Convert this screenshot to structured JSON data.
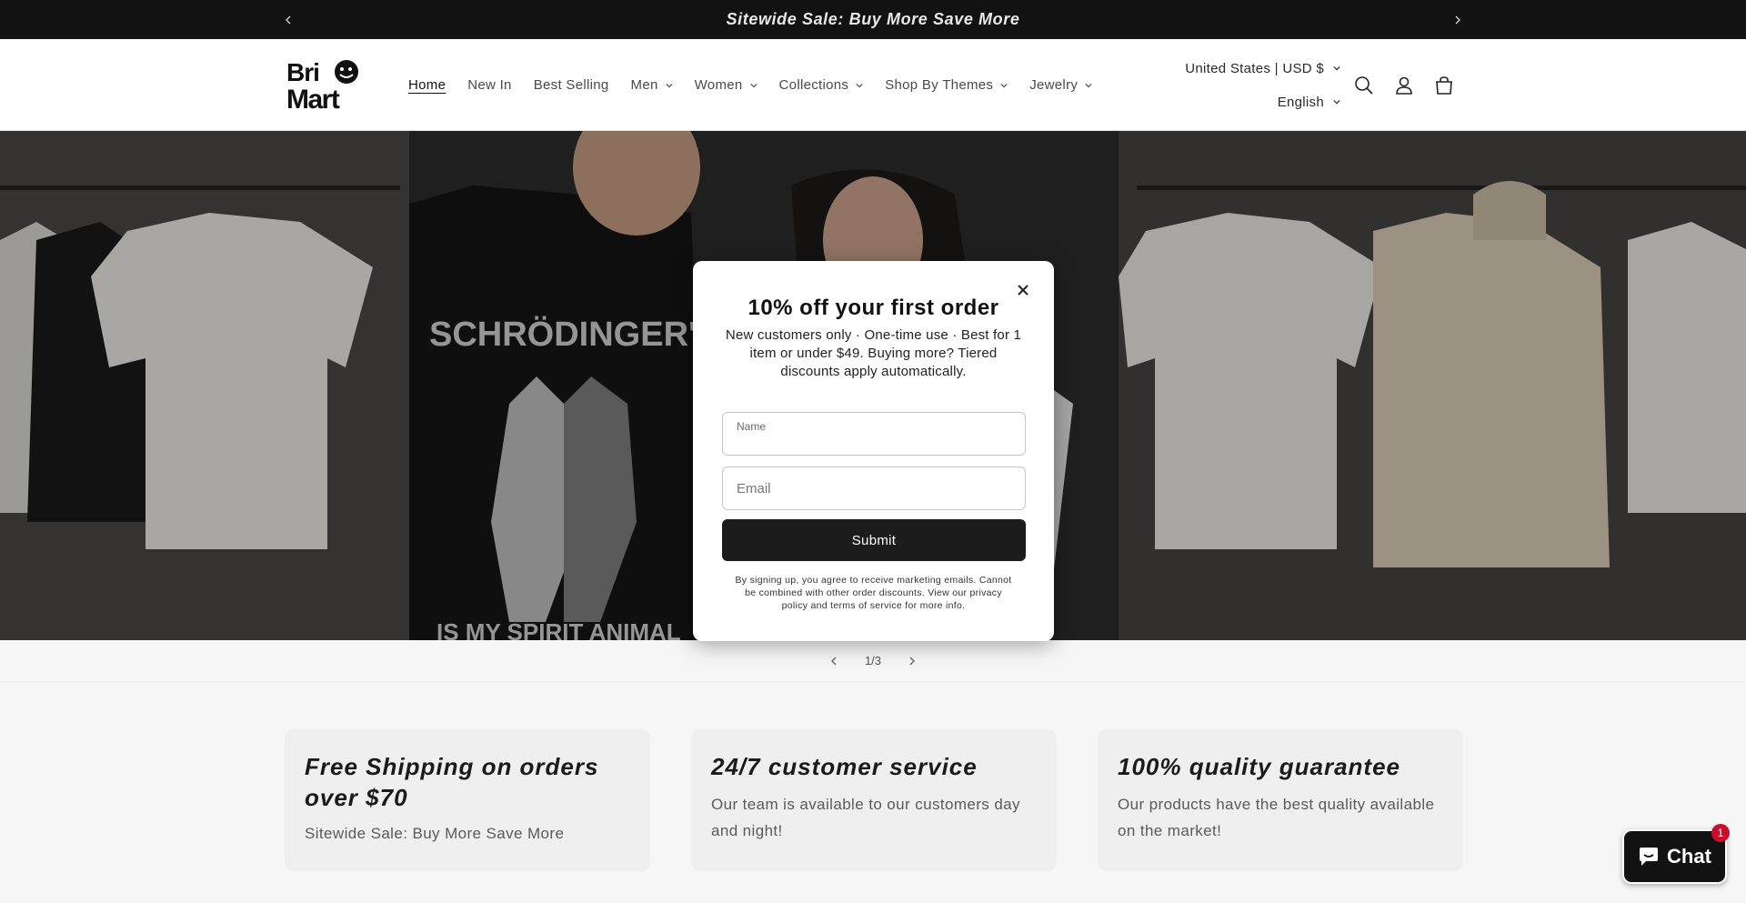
{
  "announcement": {
    "text": "Sitewide Sale: Buy More Save More",
    "prev_icon": "chevron-left-icon",
    "next_icon": "chevron-right-icon"
  },
  "header": {
    "logo_text": "BrioMart",
    "nav": [
      {
        "label": "Home",
        "active": true,
        "dropdown": false
      },
      {
        "label": "New In",
        "active": false,
        "dropdown": false
      },
      {
        "label": "Best Selling",
        "active": false,
        "dropdown": false
      },
      {
        "label": "Men",
        "active": false,
        "dropdown": true
      },
      {
        "label": "Women",
        "active": false,
        "dropdown": true
      },
      {
        "label": "Collections",
        "active": false,
        "dropdown": true
      },
      {
        "label": "Shop By Themes",
        "active": false,
        "dropdown": true
      },
      {
        "label": "Jewelry",
        "active": false,
        "dropdown": true
      }
    ],
    "currency": "United States | USD $",
    "language": "English",
    "icons": [
      "search-icon",
      "account-icon",
      "cart-icon"
    ]
  },
  "hero": {
    "shirt_print_text": "SCHRÖDINGER'S CAT",
    "shirt_print_text_bottom": "IS MY SPIRIT ANIMAL"
  },
  "slider": {
    "counter": "1/3"
  },
  "popup": {
    "title": "10% off your first order",
    "subtitle": "New customers only · One-time use · Best for 1 item or under $49. Buying more? Tiered discounts apply automatically.",
    "name_label": "Name",
    "email_placeholder": "Email",
    "submit_label": "Submit",
    "legal": "By signing up, you agree to receive marketing emails. Cannot be combined with other order discounts. View our privacy policy and terms of service for more info."
  },
  "features": [
    {
      "title": "Free Shipping on orders over $70",
      "text": "Sitewide Sale: Buy More Save More"
    },
    {
      "title": "24/7 customer service",
      "text": "Our team is available to our customers day and night!"
    },
    {
      "title": "100% quality guarantee",
      "text": "Our products have the best quality available on the market!"
    }
  ],
  "chat": {
    "label": "Chat",
    "badge": "1"
  },
  "colors": {
    "announcement_bg": "#121212",
    "button_dark": "#1c1c1c",
    "badge_red": "#c8102e"
  }
}
